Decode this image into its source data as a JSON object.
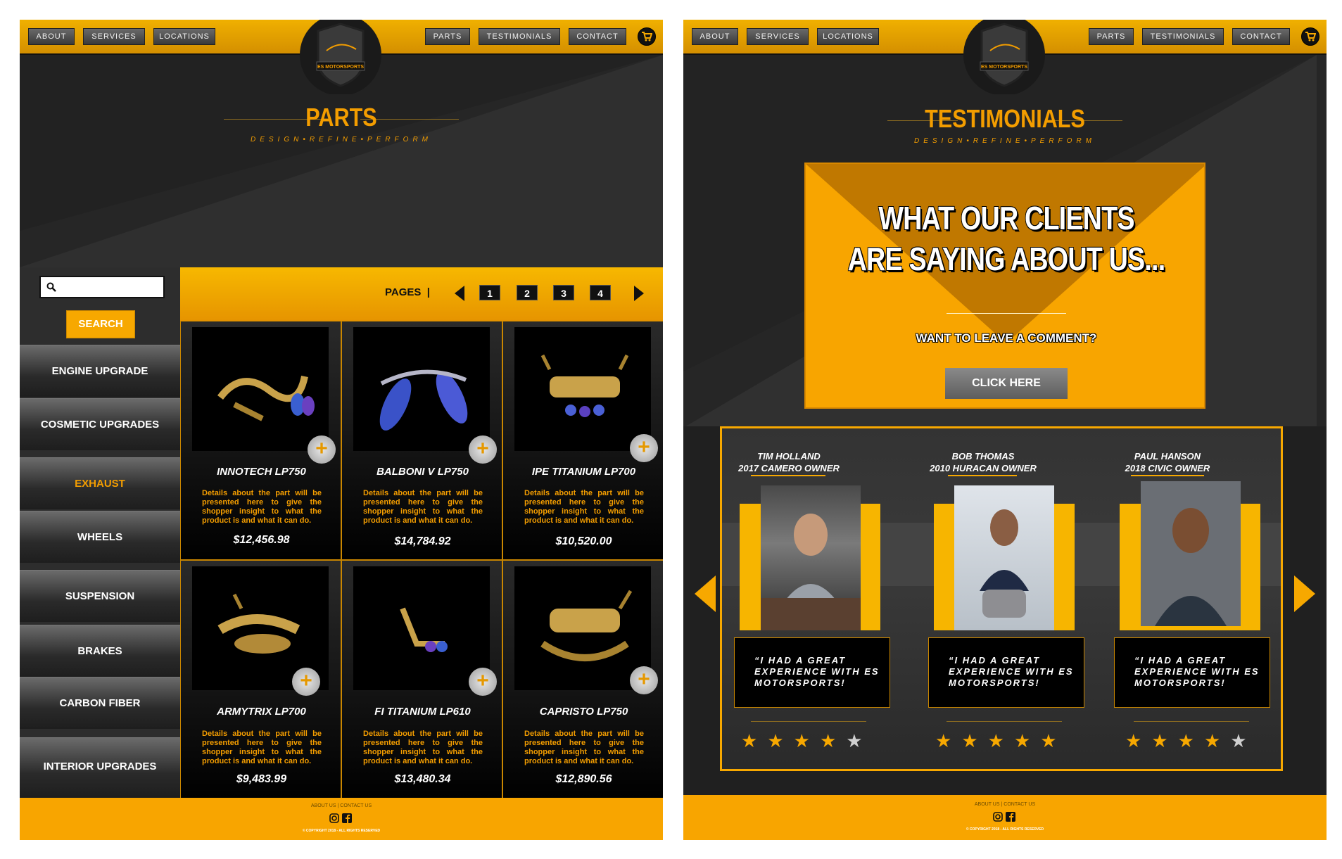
{
  "nav": {
    "left_items": [
      "ABOUT",
      "SERVICES",
      "LOCATIONS"
    ],
    "right_items": [
      "PARTS",
      "TESTIMONIALS",
      "CONTACT"
    ],
    "logo_text": "ES MOTORSPORTS"
  },
  "parts_page": {
    "title": "PARTS",
    "tagline": "DESIGN•REFINE•PERFORM",
    "search": {
      "placeholder": "",
      "button": "SEARCH"
    },
    "categories": [
      "ENGINE UPGRADE",
      "COSMETIC UPGRADES",
      "EXHAUST",
      "WHEELS",
      "SUSPENSION",
      "BRAKES",
      "CARBON FIBER",
      "INTERIOR UPGRADES"
    ],
    "active_category": "EXHAUST",
    "pagination": {
      "label": "PAGES",
      "separator": "|",
      "pages": [
        "1",
        "2",
        "3",
        "4"
      ]
    },
    "products": [
      {
        "name": "INNOTECH  LP750",
        "desc": "Details about the part will be presented here to give the shopper insight to what the product is and what it can do.",
        "price": "$12,456.98"
      },
      {
        "name": "BALBONI V LP750",
        "desc": "Details about the part will be presented here to give the shopper insight to what the product is and what it can do.",
        "price": "$14,784.92"
      },
      {
        "name": "IPE TITANIUM LP700",
        "desc": "Details about the part will be presented here to give the shopper insight to what the product is and what it can do.",
        "price": "$10,520.00"
      },
      {
        "name": "ARMYTRIX LP700",
        "desc": "Details about the part will be presented here to give the shopper insight to what the product is and what it can do.",
        "price": "$9,483.99"
      },
      {
        "name": "FI TITANIUM LP610",
        "desc": "Details about the part will be presented here to give the shopper insight to what the product is and what it can do.",
        "price": "$13,480.34"
      },
      {
        "name": "CAPRISTO LP750",
        "desc": "Details about the part will be presented here to give the shopper insight to what the product is and what it can do.",
        "price": "$12,890.56"
      }
    ],
    "plus_symbol": "+"
  },
  "testimonials_page": {
    "title": "TESTIMONIALS",
    "tagline": "DESIGN•REFINE•PERFORM",
    "headline_line1": "WHAT OUR CLIENTS",
    "headline_line2": "ARE SAYING ABOUT US...",
    "comment_prompt": "WANT TO LEAVE A COMMENT?",
    "cta_button": "CLICK HERE",
    "clients": [
      {
        "name": "TIM HOLLAND",
        "car": "2017 CAMERO OWNER",
        "quote": "“I HAD A GREAT EXPERIENCE WITH ES MOTORSPORTS!",
        "rating": 4
      },
      {
        "name": "BOB THOMAS",
        "car": "2010 HURACAN OWNER",
        "quote": "“I HAD A GREAT EXPERIENCE WITH ES MOTORSPORTS!",
        "rating": 5
      },
      {
        "name": "PAUL HANSON",
        "car": "2018 CIVIC OWNER",
        "quote": "“I HAD A GREAT EXPERIENCE WITH ES MOTORSPORTS!",
        "rating": 4
      }
    ],
    "rating_max": 5
  },
  "footer": {
    "links": [
      "ABOUT US",
      "CONTACT US"
    ],
    "link_sep": "|",
    "copyright": "© COPYRIGHT 2018 - ALL RIGHTS RESERVED"
  },
  "colors": {
    "accent": "#f7a800",
    "dark": "#262626",
    "nav_button": "#4a4a4a"
  },
  "icons": [
    "search-icon",
    "cart-icon",
    "instagram-icon",
    "facebook-icon",
    "plus-icon",
    "arrow-left-icon",
    "arrow-right-icon",
    "star-icon"
  ]
}
